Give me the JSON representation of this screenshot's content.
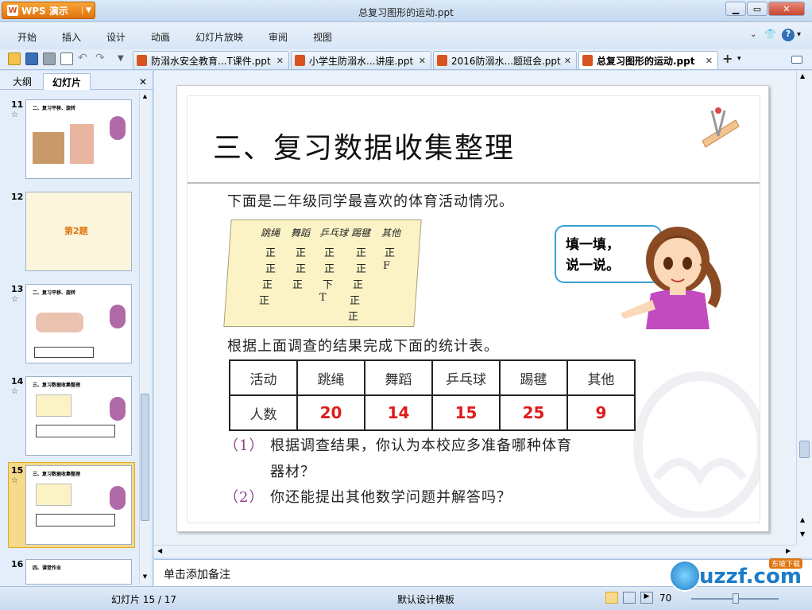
{
  "app": {
    "name": "WPS 演示",
    "window_title": "总复习图形的运动.ppt"
  },
  "menu": [
    "开始",
    "插入",
    "设计",
    "动画",
    "幻灯片放映",
    "审阅",
    "视图"
  ],
  "doc_tabs": [
    {
      "label": "防溺水安全教育...T课件.ppt",
      "active": false
    },
    {
      "label": "小学生防溺水...讲座.ppt",
      "active": false
    },
    {
      "label": "2016防溺水...题班会.ppt",
      "active": false
    },
    {
      "label": "总复习图形的运动.ppt",
      "active": true
    }
  ],
  "left_panel": {
    "tabs": [
      "大纲",
      "幻灯片"
    ],
    "active_tab": "幻灯片",
    "slides": [
      {
        "num": "11",
        "title": "二、复习平移、旋转",
        "star": true
      },
      {
        "num": "12",
        "title": "第2题",
        "star": false
      },
      {
        "num": "13",
        "title": "二、复习平移、旋转",
        "star": true
      },
      {
        "num": "14",
        "title": "三、复习数据收集整理",
        "star": true
      },
      {
        "num": "15",
        "title": "三、复习数据收集整理",
        "star": true,
        "selected": true
      },
      {
        "num": "16",
        "title": "四、课堂作业",
        "star": false
      }
    ]
  },
  "slide": {
    "title": "三、复习数据收集整理",
    "intro": "下面是二年级同学最喜欢的体育活动情况。",
    "tally": {
      "headers": [
        "跳绳",
        "舞蹈",
        "乒乓球",
        "踢毽",
        "其他"
      ],
      "columns": [
        [
          "正",
          "正",
          "正",
          "正"
        ],
        [
          "正",
          "正",
          "正"
        ],
        [
          "正",
          "正",
          "下",
          "T"
        ],
        [
          "正",
          "正",
          "正",
          "正",
          "正"
        ],
        [
          "正",
          "F"
        ]
      ]
    },
    "bubble": {
      "line1": "填一填，",
      "line2": "说一说。"
    },
    "instruction": "根据上面调查的结果完成下面的统计表。",
    "table": {
      "header_label": "活动",
      "activities": [
        "跳绳",
        "舞蹈",
        "乒乓球",
        "踢毽",
        "其他"
      ],
      "row_label": "人数",
      "counts": [
        "20",
        "14",
        "15",
        "25",
        "9"
      ]
    },
    "q1_num": "（1）",
    "q1_line1": "根据调查结果，你认为本校应多准备哪种体育",
    "q1_line2": "器材？",
    "q2_num": "（2）",
    "q2": "你还能提出其他数学问题并解答吗？"
  },
  "notes_placeholder": "单击添加备注",
  "status": {
    "slide_counter": "幻灯片 15 / 17",
    "template": "默认设计模板",
    "zoom": "70"
  },
  "watermark": {
    "text": "uzzf.com",
    "sub": "东坡下载"
  },
  "colors": {
    "accent": "#e07612",
    "number_red": "#e01b1b",
    "bubble_border": "#3aa0d0",
    "question_num": "#8a3f8f"
  }
}
